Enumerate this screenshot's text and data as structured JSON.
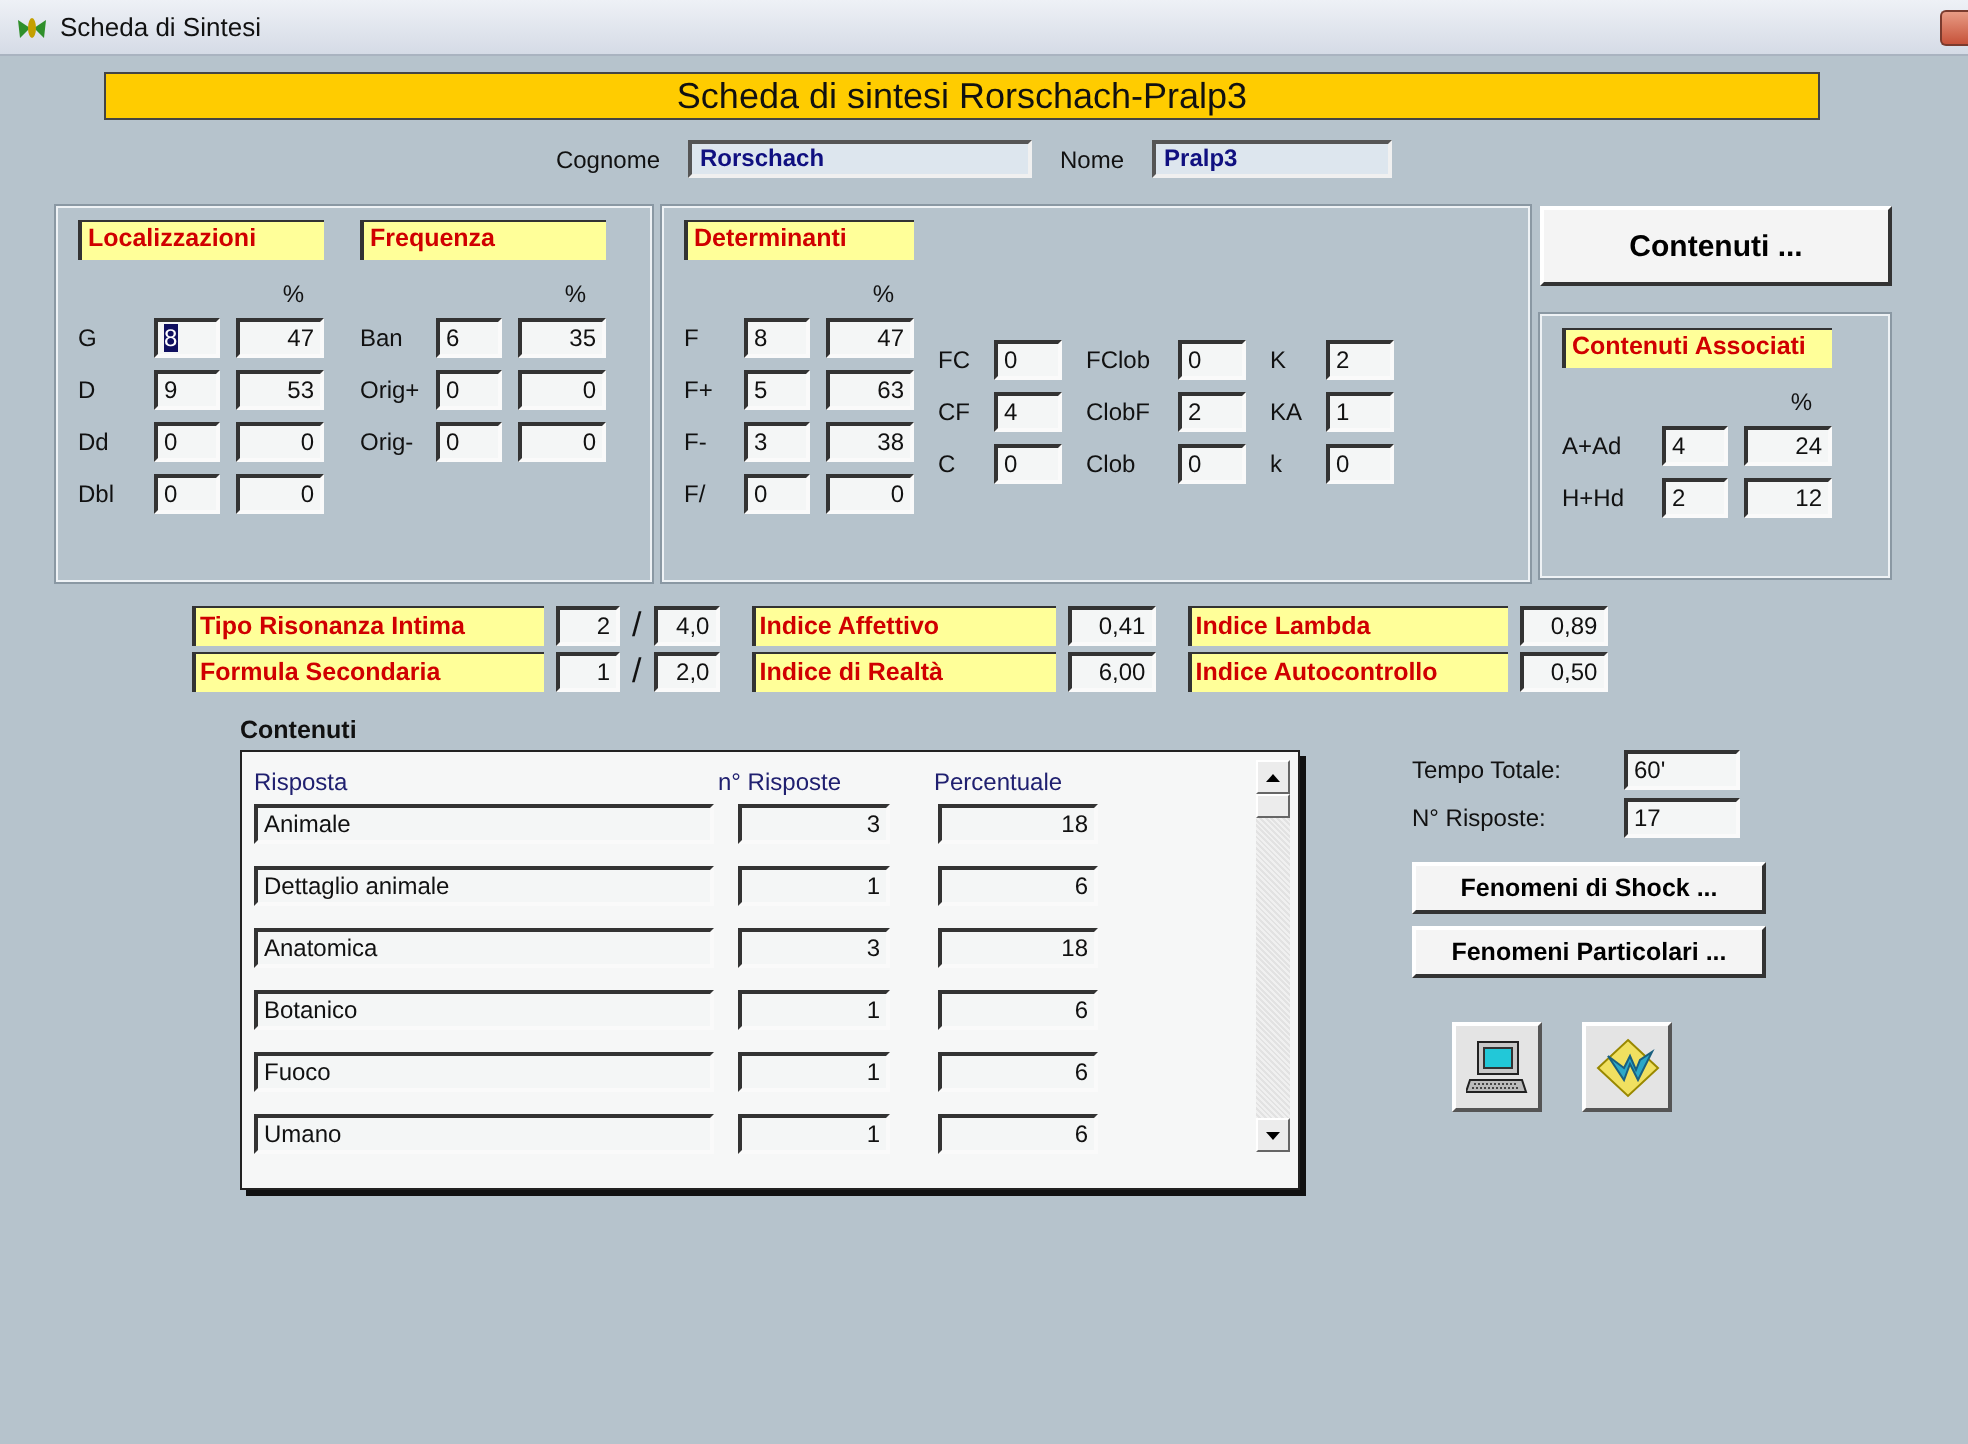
{
  "window": {
    "title": "Scheda di Sintesi"
  },
  "banner": "Scheda di sintesi Rorschach-Pralp3",
  "identity": [
    {
      "label": "Cognome",
      "value": "Rorschach"
    },
    {
      "label": "Nome",
      "value": "Pralp3"
    }
  ],
  "localizzazioni": {
    "title": "Localizzazioni",
    "percent_header": "%",
    "rows": [
      {
        "label": "G",
        "count": "8",
        "percent": "47",
        "focused": true
      },
      {
        "label": "D",
        "count": "9",
        "percent": "53",
        "focused": false
      },
      {
        "label": "Dd",
        "count": "0",
        "percent": "0",
        "focused": false
      },
      {
        "label": "Dbl",
        "count": "0",
        "percent": "0",
        "focused": false
      }
    ]
  },
  "frequenza": {
    "title": "Frequenza",
    "percent_header": "%",
    "rows": [
      {
        "label": "Ban",
        "count": "6",
        "percent": "35"
      },
      {
        "label": "Orig+",
        "count": "0",
        "percent": "0"
      },
      {
        "label": "Orig-",
        "count": "0",
        "percent": "0"
      }
    ]
  },
  "determinanti": {
    "title": "Determinanti",
    "percent_header": "%",
    "rows": [
      {
        "label": "F",
        "count": "8",
        "percent": "47"
      },
      {
        "label": "F+",
        "count": "5",
        "percent": "63"
      },
      {
        "label": "F-",
        "count": "3",
        "percent": "38"
      },
      {
        "label": "F/",
        "count": "0",
        "percent": "0"
      }
    ],
    "columns": [
      [
        {
          "label": "FC",
          "value": "0"
        },
        {
          "label": "CF",
          "value": "4"
        },
        {
          "label": "C",
          "value": "0"
        }
      ],
      [
        {
          "label": "FClob",
          "value": "0"
        },
        {
          "label": "ClobF",
          "value": "2"
        },
        {
          "label": "Clob",
          "value": "0"
        }
      ],
      [
        {
          "label": "K",
          "value": "2"
        },
        {
          "label": "KA",
          "value": "1"
        },
        {
          "label": "k",
          "value": "0"
        }
      ]
    ]
  },
  "contenuti_button": "Contenuti ...",
  "contenuti_associati": {
    "title": "Contenuti Associati",
    "percent_header": "%",
    "rows": [
      {
        "label": "A+Ad",
        "count": "4",
        "percent": "24"
      },
      {
        "label": "H+Hd",
        "count": "2",
        "percent": "12"
      }
    ]
  },
  "indices": [
    {
      "kind": "ratio",
      "label": "Tipo Risonanza Intima",
      "value": "2",
      "separator": "/",
      "ratio": "4,0"
    },
    {
      "kind": "single",
      "label": "Indice Affettivo",
      "value": "0,41"
    },
    {
      "kind": "single",
      "label": "Indice Lambda",
      "value": "0,89"
    },
    {
      "kind": "ratio",
      "label": "Formula Secondaria",
      "value": "1",
      "separator": "/",
      "ratio": "2,0"
    },
    {
      "kind": "single",
      "label": "Indice di Realtà",
      "value": "6,00"
    },
    {
      "kind": "single",
      "label": "Indice Autocontrollo",
      "value": "0,50"
    }
  ],
  "contenuti": {
    "title": "Contenuti",
    "columns": [
      "Risposta",
      "n° Risposte",
      "Percentuale"
    ],
    "rows": [
      [
        "Animale",
        "3",
        "18"
      ],
      [
        "Dettaglio animale",
        "1",
        "6"
      ],
      [
        "Anatomica",
        "3",
        "18"
      ],
      [
        "Botanico",
        "1",
        "6"
      ],
      [
        "Fuoco",
        "1",
        "6"
      ],
      [
        "Umano",
        "1",
        "6"
      ]
    ]
  },
  "totals": [
    {
      "label": "Tempo Totale:",
      "value": "60'"
    },
    {
      "label": "N° Risposte:",
      "value": "17"
    }
  ],
  "buttons": [
    "Fenomeni di Shock ...",
    "Fenomeni Particolari ..."
  ]
}
